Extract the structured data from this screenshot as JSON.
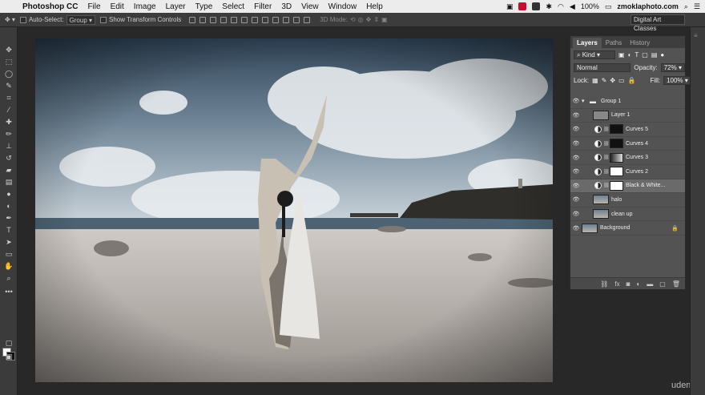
{
  "menubar": {
    "app": "Photoshop CC",
    "items": [
      "File",
      "Edit",
      "Image",
      "Layer",
      "Type",
      "Select",
      "Filter",
      "3D",
      "View",
      "Window",
      "Help"
    ],
    "battery": "100%",
    "domain": "zmoklaphoto.com"
  },
  "options": {
    "autoselect_label": "Auto-Select:",
    "autoselect_value": "Group",
    "transform_label": "Show Transform Controls",
    "mode3d_label": "3D Mode:",
    "workspace": "Digital Art Classes"
  },
  "layers_panel": {
    "tabs": [
      "Layers",
      "Paths",
      "History"
    ],
    "kind_label": "Kind",
    "blend_mode": "Normal",
    "opacity_label": "Opacity:",
    "opacity_value": "72%",
    "lock_label": "Lock:",
    "fill_label": "Fill:",
    "fill_value": "100%",
    "layers": [
      {
        "name": "Group 1",
        "type": "group"
      },
      {
        "name": "Layer 1",
        "type": "pixel",
        "thumb": "#888888"
      },
      {
        "name": "Curves 5",
        "type": "adjust",
        "mask": "dark"
      },
      {
        "name": "Curves 4",
        "type": "adjust",
        "mask": "dark"
      },
      {
        "name": "Curves 3",
        "type": "adjust",
        "mask": "mixed"
      },
      {
        "name": "Curves 2",
        "type": "adjust",
        "mask": "white"
      },
      {
        "name": "Black & White...",
        "type": "adjust",
        "mask": "white",
        "selected": true
      },
      {
        "name": "halo",
        "type": "photo"
      },
      {
        "name": "clean up",
        "type": "photo"
      },
      {
        "name": "Background",
        "type": "photo",
        "locked": true
      }
    ]
  },
  "watermark": "udemy",
  "colors": {
    "menubar": "#ececec",
    "panel": "#535353",
    "toolbar": "#3b3b3b",
    "accent_red": "#c8102e"
  }
}
